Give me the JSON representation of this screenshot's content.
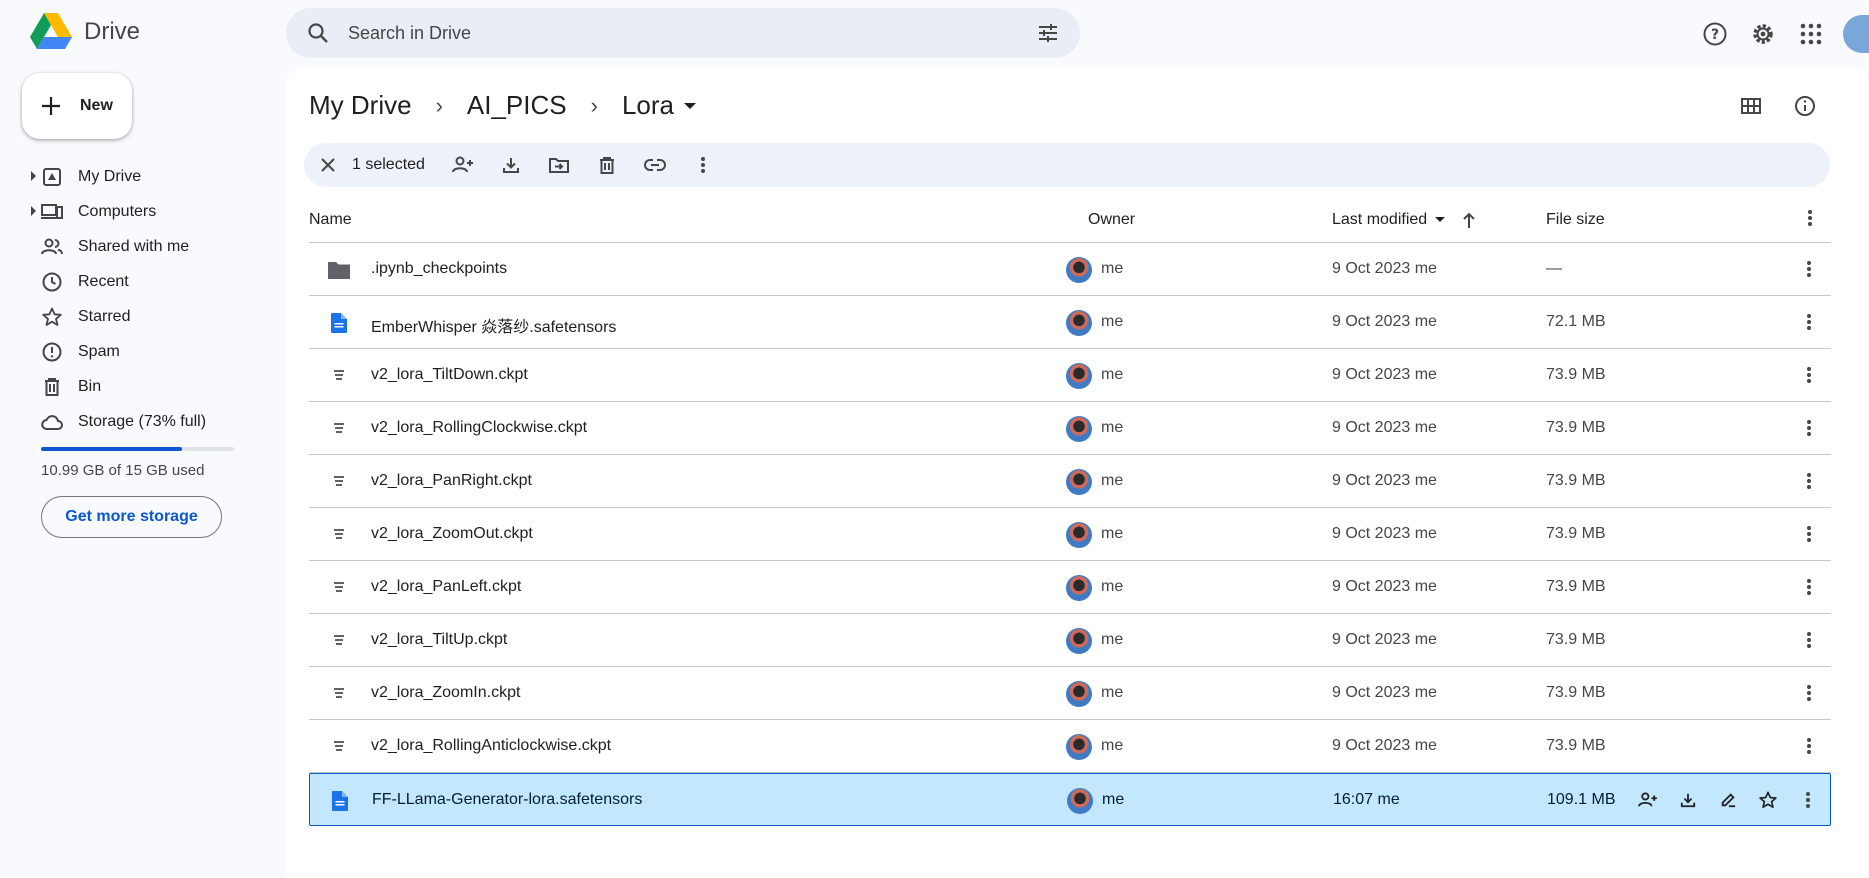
{
  "app": {
    "name": "Drive"
  },
  "search": {
    "placeholder": "Search in Drive"
  },
  "sidebar": {
    "new_label": "New",
    "items": [
      {
        "label": "My Drive",
        "icon": "my-drive-icon"
      },
      {
        "label": "Computers",
        "icon": "computers-icon"
      },
      {
        "label": "Shared with me",
        "icon": "shared-icon"
      },
      {
        "label": "Recent",
        "icon": "clock-icon"
      },
      {
        "label": "Starred",
        "icon": "star-icon"
      },
      {
        "label": "Spam",
        "icon": "spam-icon"
      },
      {
        "label": "Bin",
        "icon": "trash-icon"
      },
      {
        "label": "Storage (73% full)",
        "icon": "cloud-icon"
      }
    ],
    "storage_used_fraction": 0.73,
    "storage_text": "10.99 GB of 15 GB used",
    "get_storage_label": "Get more storage"
  },
  "breadcrumb": [
    "My Drive",
    "AI_PICS",
    "Lora"
  ],
  "selection": {
    "count_label": "1 selected"
  },
  "table": {
    "headers": {
      "name": "Name",
      "owner": "Owner",
      "modified": "Last modified",
      "size": "File size"
    },
    "rows": [
      {
        "name": ".ipynb_checkpoints",
        "type": "folder",
        "owner": "me",
        "modified": "9 Oct 2023 me",
        "size": "—"
      },
      {
        "name": "EmberWhisper 焱落纱.safetensors",
        "type": "doc",
        "owner": "me",
        "modified": "9 Oct 2023 me",
        "size": "72.1 MB"
      },
      {
        "name": "v2_lora_TiltDown.ckpt",
        "type": "file",
        "owner": "me",
        "modified": "9 Oct 2023 me",
        "size": "73.9 MB"
      },
      {
        "name": "v2_lora_RollingClockwise.ckpt",
        "type": "file",
        "owner": "me",
        "modified": "9 Oct 2023 me",
        "size": "73.9 MB"
      },
      {
        "name": "v2_lora_PanRight.ckpt",
        "type": "file",
        "owner": "me",
        "modified": "9 Oct 2023 me",
        "size": "73.9 MB"
      },
      {
        "name": "v2_lora_ZoomOut.ckpt",
        "type": "file",
        "owner": "me",
        "modified": "9 Oct 2023 me",
        "size": "73.9 MB"
      },
      {
        "name": "v2_lora_PanLeft.ckpt",
        "type": "file",
        "owner": "me",
        "modified": "9 Oct 2023 me",
        "size": "73.9 MB"
      },
      {
        "name": "v2_lora_TiltUp.ckpt",
        "type": "file",
        "owner": "me",
        "modified": "9 Oct 2023 me",
        "size": "73.9 MB"
      },
      {
        "name": "v2_lora_ZoomIn.ckpt",
        "type": "file",
        "owner": "me",
        "modified": "9 Oct 2023 me",
        "size": "73.9 MB"
      },
      {
        "name": "v2_lora_RollingAnticlockwise.ckpt",
        "type": "file",
        "owner": "me",
        "modified": "9 Oct 2023 me",
        "size": "73.9 MB"
      },
      {
        "name": "FF-LLama-Generator-lora.safetensors",
        "type": "doc",
        "owner": "me",
        "modified": "16:07 me",
        "size": "109.1 MB",
        "selected": true
      }
    ]
  },
  "colors": {
    "accent": "#0b57d0",
    "selected_row": "#c2e7ff",
    "doc_icon": "#1a73e8",
    "folder_icon": "#5f6368"
  }
}
